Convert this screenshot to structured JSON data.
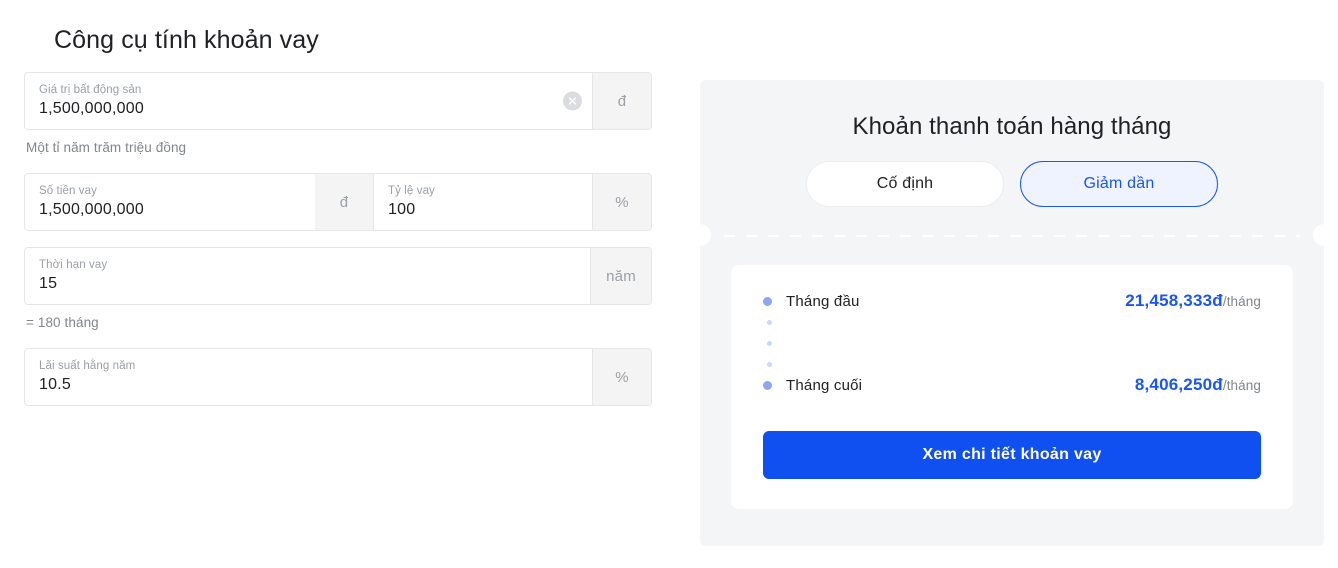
{
  "page": {
    "title": "Công cụ tính khoản vay"
  },
  "form": {
    "property_value": {
      "label": "Giá trị bất động sản",
      "value": "1,500,000,000",
      "suffix": "đ",
      "clear_icon": "close-circle-icon",
      "helper": "Một tỉ năm trăm triệu đồng"
    },
    "loan_amount": {
      "label": "Số tiền vay",
      "value": "1,500,000,000",
      "suffix": "đ"
    },
    "loan_ratio": {
      "label": "Tỷ lệ vay",
      "value": "100",
      "suffix": "%"
    },
    "loan_term": {
      "label": "Thời hạn vay",
      "value": "15",
      "suffix": "năm",
      "helper": "= 180 tháng"
    },
    "interest_rate": {
      "label": "Lãi suất hằng năm",
      "value": "10.5",
      "suffix": "%"
    }
  },
  "result_panel": {
    "heading": "Khoản thanh toán hàng tháng",
    "toggles": [
      {
        "label": "Cố định",
        "active": false
      },
      {
        "label": "Giảm dần",
        "active": true
      }
    ],
    "rows": [
      {
        "label": "Tháng đầu",
        "amount": "21,458,333đ",
        "unit": "/tháng"
      },
      {
        "label": "Tháng cuối",
        "amount": "8,406,250đ",
        "unit": "/tháng"
      }
    ],
    "cta_label": "Xem chi tiết khoản vay"
  },
  "colors": {
    "accent_blue": "#1a56f0",
    "cta_blue": "#1150f0",
    "panel_grey": "#f4f5f6",
    "suffix_grey": "#f4f4f5",
    "bullet_blue": "#8ca7ef",
    "label_grey": "#9aa0a6"
  }
}
